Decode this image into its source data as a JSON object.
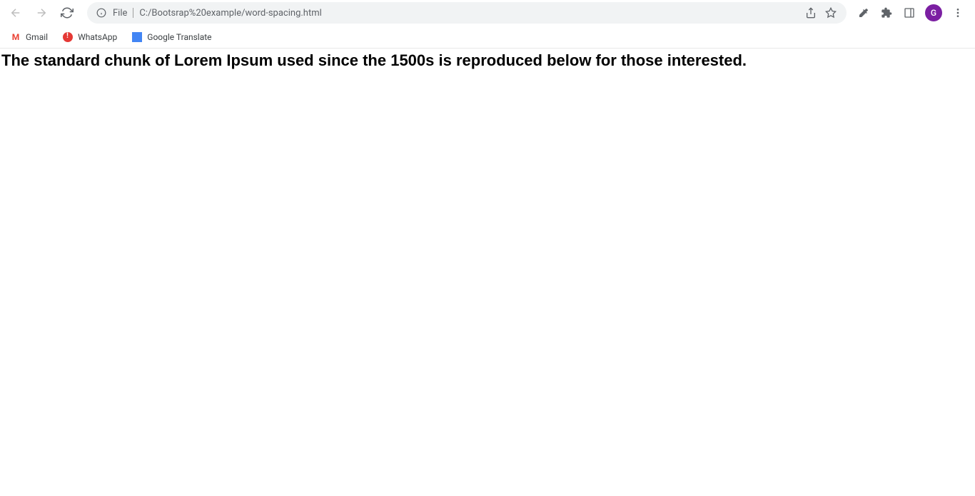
{
  "toolbar": {
    "file_label": "File",
    "url": "C:/Bootsrap%20example/word-spacing.html",
    "profile_letter": "G"
  },
  "bookmarks": {
    "gmail": "Gmail",
    "whatsapp": "WhatsApp",
    "translate": "Google Translate"
  },
  "content": {
    "heading": "The standard chunk of Lorem Ipsum used since the 1500s is reproduced below for those interested."
  }
}
